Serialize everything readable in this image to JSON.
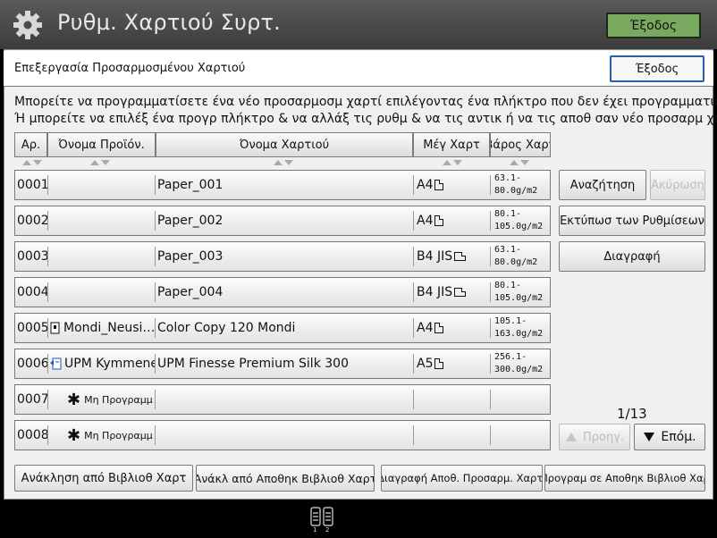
{
  "header": {
    "title": "Ρυθμ. Χαρτιού Συρτ.",
    "exit_label": "Έξοδος"
  },
  "subheader": {
    "title": "Επεξεργασία Προσαρμοσμένου Χαρτιού",
    "exit_label": "Έξοδος"
  },
  "message": {
    "line1": "Μπορείτε να προγραμματίσετε ένα νέο προσαρμοσμ χαρτί επιλέγοντας ένα πλήκτρο που δεν έχει προγραμματιστεί.",
    "line2": "Ή μπορείτε να επιλέξ ένα προγρ πλήκτρο & να αλλάξ τις ρυθμ & να τις αντικ ή να τις αποθ σαν νέο προσαρμ χαρ."
  },
  "columns": {
    "no": "Αρ.",
    "product": "Όνομα Προϊόν.",
    "paper": "Όνομα Χαρτιού",
    "size": "Μέγ Χαρτ",
    "weight": "Βάρος Χαρτ"
  },
  "rows": [
    {
      "no": "0001",
      "product": "",
      "paper": "Paper_001",
      "size": "A4",
      "orient": "portrait",
      "weight1": "63.1-",
      "weight2": "80.0g/m2"
    },
    {
      "no": "0002",
      "product": "",
      "paper": "Paper_002",
      "size": "A4",
      "orient": "portrait",
      "weight1": "80.1-",
      "weight2": "105.0g/m2"
    },
    {
      "no": "0003",
      "product": "",
      "paper": "Paper_003",
      "size": "B4 JIS",
      "orient": "landscape",
      "weight1": "63.1-",
      "weight2": "80.0g/m2"
    },
    {
      "no": "0004",
      "product": "",
      "paper": "Paper_004",
      "size": "B4 JIS",
      "orient": "landscape",
      "weight1": "80.1-",
      "weight2": "105.0g/m2"
    },
    {
      "no": "0005",
      "product": "Mondi_Neusi…",
      "paper": "Color Copy 120 Mondi",
      "size": "A4",
      "orient": "portrait",
      "weight1": "105.1-",
      "weight2": "163.0g/m2"
    },
    {
      "no": "0006",
      "product": "UPM Kymmene…",
      "paper": "UPM Finesse Premium Silk 300",
      "size": "A5",
      "orient": "portrait",
      "weight1": "256.1-",
      "weight2": "300.0g/m2"
    },
    {
      "no": "0007",
      "product": "Μη Προγραμμ",
      "paper": "",
      "size": "",
      "orient": "",
      "weight1": "",
      "weight2": ""
    },
    {
      "no": "0008",
      "product": "Μη Προγραμμ",
      "paper": "",
      "size": "",
      "orient": "",
      "weight1": "",
      "weight2": ""
    }
  ],
  "side_buttons": {
    "search": "Αναζήτηση",
    "cancel": "Ακύρωση",
    "print": "Εκτύπωσ των Ρυθμίσεων",
    "delete": "Διαγραφή"
  },
  "pager": {
    "page": "1/13",
    "prev": "Προηγ.",
    "next": "Επόμ."
  },
  "bottom_buttons": {
    "recall": "Ανάκληση από Βιβλιοθ Χαρτ",
    "recall_stored": "Ανάκλ από Αποθηκ Βιβλιοθ Χαρτ",
    "delete_stored": "Διαγραφή Αποθ. Προσαρμ. Χαρτ.",
    "program_stored": "Πρoγραμ σε Αποθηκ Βιβλιοθ Χαρ"
  },
  "status": {
    "tray_1": "1",
    "tray_2": "2"
  },
  "colors": {
    "accent_exit": "#79a95f",
    "selected_border": "#2a5fa8",
    "topbar": "#4a4a4a"
  }
}
